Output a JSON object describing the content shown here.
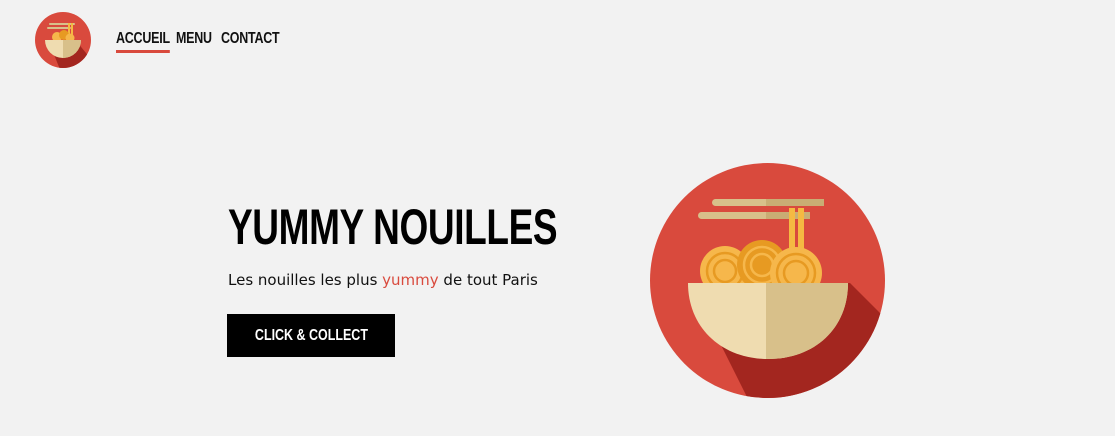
{
  "nav": {
    "logo": "ramen-bowl-logo",
    "items": [
      {
        "label": "ACCUEIL",
        "active": true
      },
      {
        "label": "MENU",
        "active": false
      },
      {
        "label": "CONTACT",
        "active": false
      }
    ]
  },
  "hero": {
    "title": "YUMMY NOUILLES",
    "tagline_before": "Les nouilles les plus ",
    "tagline_accent": "yummy",
    "tagline_after": " de tout Paris",
    "cta_label": "CLICK & COLLECT",
    "image": "ramen-bowl-illustration"
  },
  "colors": {
    "background": "#f2f2f2",
    "accent": "#d94a3d",
    "button": "#000000"
  }
}
